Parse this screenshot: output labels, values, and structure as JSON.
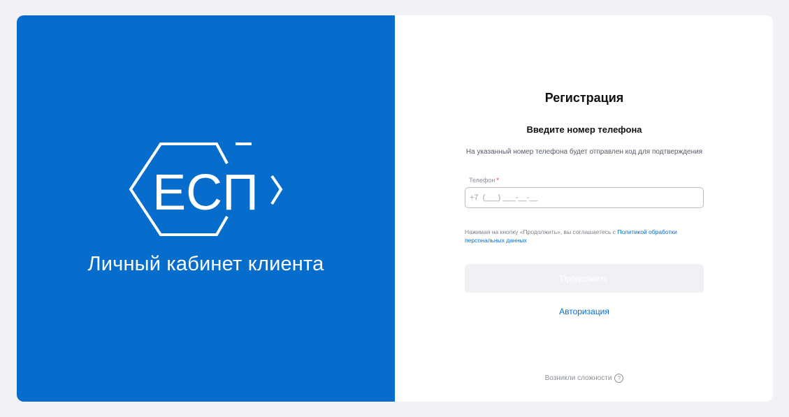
{
  "brand": {
    "logo_text": "ЕСП",
    "title": "Личный кабинет клиента"
  },
  "form": {
    "title": "Регистрация",
    "subtitle": "Введите номер телефона",
    "description": "На указанный номер телефона будет отправлен код для подтверждения",
    "phone_label": "Телефон",
    "required_mark": "*",
    "phone_placeholder": "+7  (___) ___-__-__",
    "phone_value": "",
    "consent_prefix": "Нажимая на кнопку «Продолжить», вы соглашаетесь с ",
    "consent_link": "Политикой обработки персональных данных",
    "continue_label": "Продолжить",
    "auth_link": "Авторизация",
    "help_text": "Возникли сложности",
    "help_icon_glyph": "?"
  },
  "colors": {
    "brand_blue": "#066dcc",
    "page_background": "#f0f2f6",
    "button_disabled": "#eff1f5",
    "required": "#e5322d"
  },
  "icons": {
    "logo": "esp-hexagon-logo-icon",
    "help": "question-circle-icon"
  }
}
